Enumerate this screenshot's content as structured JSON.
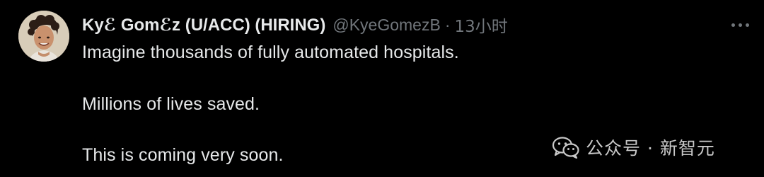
{
  "tweet": {
    "author": {
      "display_name": "Kyℰ Gomℰz (U/ACC) (HIRING)",
      "handle": "@KyeGomezB"
    },
    "separator": "·",
    "timestamp": "13小时",
    "more_icon": "more-horizontal-icon",
    "lines": [
      "Imagine thousands of fully automated hospitals.",
      "Millions of lives saved.",
      "This is coming very soon."
    ]
  },
  "watermark": {
    "icon": "wechat-icon",
    "text": "公众号 · 新智元"
  },
  "colors": {
    "background": "#000000",
    "primary_text": "#e7e9ea",
    "secondary_text": "#71767b"
  }
}
